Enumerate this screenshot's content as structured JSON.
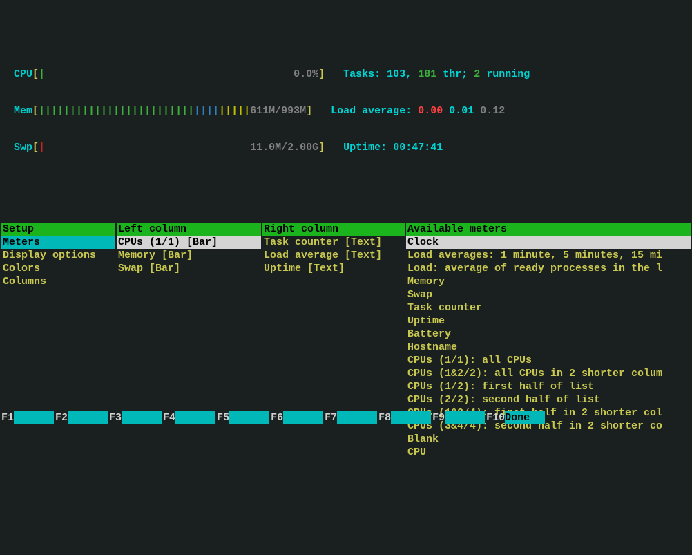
{
  "meters": {
    "cpu": {
      "label": "CPU",
      "bar_green": "|",
      "value": "0.0%"
    },
    "mem": {
      "label": "Mem",
      "value_left": "611M/99",
      "value_right": "3M"
    },
    "swp": {
      "label": "Swp",
      "value": "11.0M/2.00G"
    }
  },
  "stats": {
    "tasks_label": "Tasks: ",
    "tasks_a": "103",
    "tasks_b": "181",
    "thr": " thr; ",
    "running_n": "2",
    "running_lbl": " running",
    "load_label": "Load average: ",
    "load1": "0.00",
    "load2": "0.01",
    "load3": "0.12",
    "uptime_label": "Uptime: ",
    "uptime": "00:47:41"
  },
  "setup": {
    "header": "Setup",
    "items": [
      "Meters",
      "Display options",
      "Colors",
      "Columns"
    ],
    "selected": 0
  },
  "left": {
    "header": "Left column",
    "items": [
      "CPUs (1/1) [Bar]",
      "Memory [Bar]",
      "Swap [Bar]"
    ],
    "selected": 0
  },
  "right": {
    "header": "Right column",
    "items": [
      "Task counter [Text]",
      "Load average [Text]",
      "Uptime [Text]"
    ]
  },
  "avail": {
    "header": "Available meters",
    "items": [
      "Clock",
      "Load averages: 1 minute, 5 minutes, 15 mi",
      "Load: average of ready processes in the l",
      "Memory",
      "Swap",
      "Task counter",
      "Uptime",
      "Battery",
      "Hostname",
      "CPUs (1/1): all CPUs",
      "CPUs (1&2/2): all CPUs in 2 shorter colum",
      "CPUs (1/2): first half of list",
      "CPUs (2/2): second half of list",
      "CPUs (1&2/4): first half in 2 shorter col",
      "CPUs (3&4/4): second half in 2 shorter co",
      "Blank",
      "CPU"
    ],
    "selected": 0
  },
  "fkeys": [
    {
      "n": "F1",
      "label": "      "
    },
    {
      "n": "F2",
      "label": "      "
    },
    {
      "n": "F3",
      "label": "      "
    },
    {
      "n": "F4",
      "label": "      "
    },
    {
      "n": "F5",
      "label": "      "
    },
    {
      "n": "F6",
      "label": "      "
    },
    {
      "n": "F7",
      "label": "      "
    },
    {
      "n": "F8",
      "label": "      "
    },
    {
      "n": "F9",
      "label": "      "
    },
    {
      "n": "F10",
      "label": "Done  "
    }
  ]
}
